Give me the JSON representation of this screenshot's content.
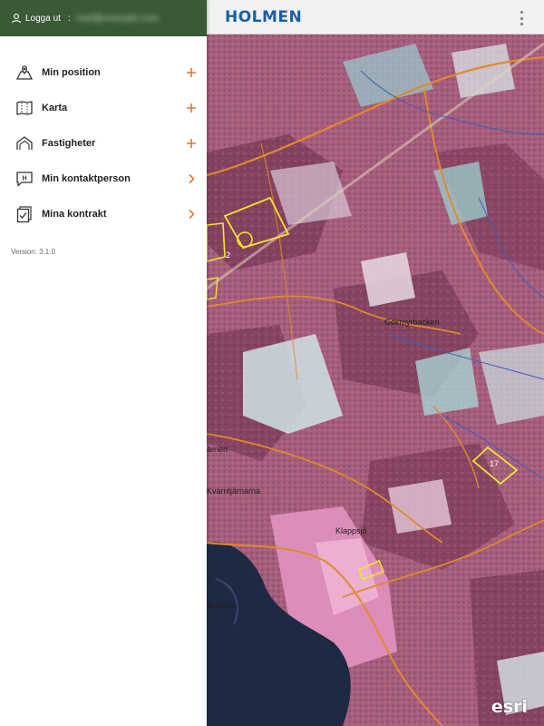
{
  "colors": {
    "header_bg": "#3a5a35",
    "brand": "#1a5fa8",
    "accent": "#e0792b",
    "map_base": "#a8607f"
  },
  "drawer": {
    "logout_label": "Logga ut",
    "separator": ":",
    "email": "mail@example.com",
    "menu": [
      {
        "label": "Min position",
        "icon": "map-pin-icon",
        "action": "plus"
      },
      {
        "label": "Karta",
        "icon": "map-icon",
        "action": "plus"
      },
      {
        "label": "Fastigheter",
        "icon": "property-icon",
        "action": "plus"
      },
      {
        "label": "Min kontaktperson",
        "icon": "contact-icon",
        "action": "chevron"
      },
      {
        "label": "Mina kontrakt",
        "icon": "contract-icon",
        "action": "chevron"
      }
    ],
    "version": "Version: 3.1.0"
  },
  "topbar": {
    "brand": "HOLMEN",
    "menu_icon": "kebab-menu-icon"
  },
  "map": {
    "labels": [
      "Gökmyrbacken",
      "ärnen",
      "Kvarntjärnarna",
      "Klappsjö",
      "läppsjön"
    ],
    "parcel_numbers": [
      "2",
      "17"
    ],
    "attribution": "esri"
  }
}
